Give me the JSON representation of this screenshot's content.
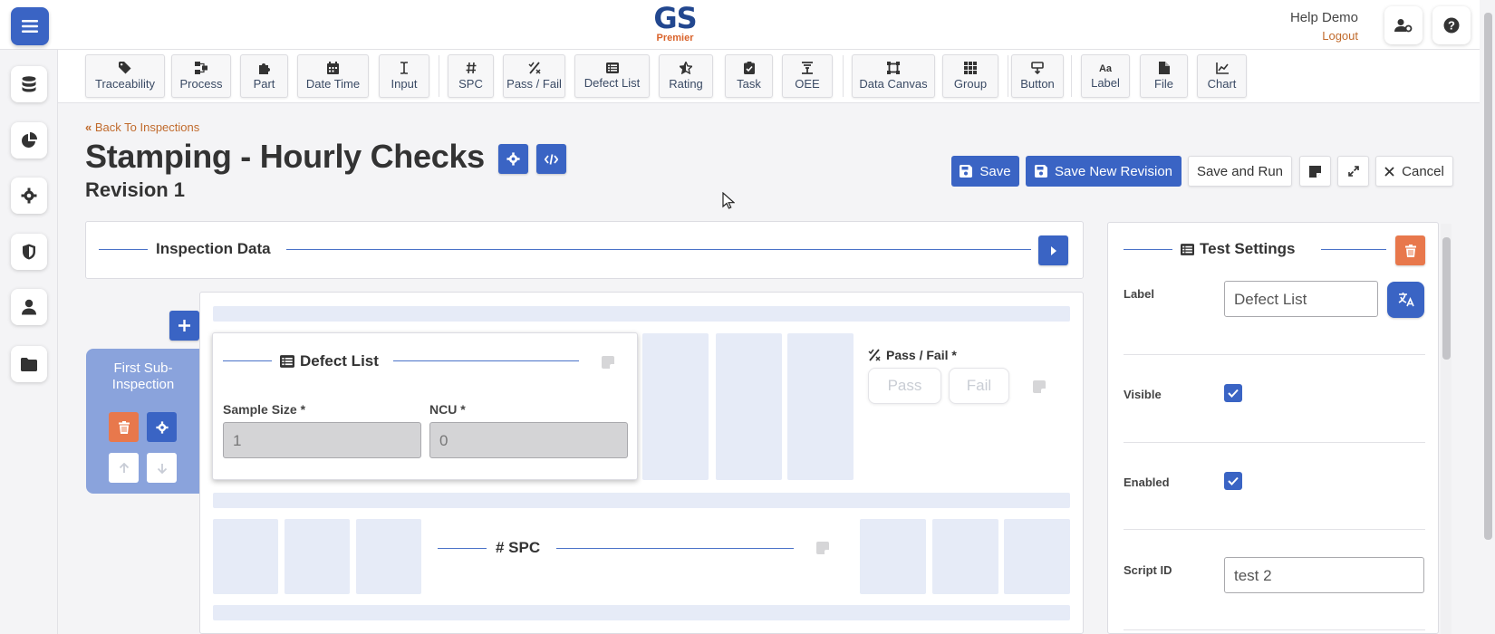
{
  "header": {
    "logo_main": "GS",
    "logo_sub": "Premier",
    "user_name": "Help Demo",
    "logout_label": "Logout"
  },
  "toolbar": {
    "items": [
      {
        "label": "Traceability",
        "icon": "tag-icon"
      },
      {
        "label": "Process",
        "icon": "process-icon"
      },
      {
        "label": "Part",
        "icon": "puzzle-icon"
      },
      {
        "label": "Date Time",
        "icon": "calendar-icon"
      },
      {
        "label": "Input",
        "icon": "text-cursor-icon"
      },
      {
        "label": "SPC",
        "icon": "hash-icon"
      },
      {
        "label": "Pass / Fail",
        "icon": "percent-icon"
      },
      {
        "label": "Defect List",
        "icon": "list-icon"
      },
      {
        "label": "Rating",
        "icon": "star-icon"
      },
      {
        "label": "Task",
        "icon": "clipboard-check-icon"
      },
      {
        "label": "OEE",
        "icon": "oee-icon"
      },
      {
        "label": "Data Canvas",
        "icon": "canvas-icon"
      },
      {
        "label": "Group",
        "icon": "grid-icon"
      },
      {
        "label": "Button",
        "icon": "button-icon"
      },
      {
        "label": "Label",
        "icon": "label-icon"
      },
      {
        "label": "File",
        "icon": "file-icon"
      },
      {
        "label": "Chart",
        "icon": "chart-icon"
      }
    ]
  },
  "page": {
    "back_label": "Back To Inspections",
    "title": "Stamping - Hourly Checks",
    "subtitle": "Revision 1"
  },
  "actions": {
    "save": "Save",
    "save_new_revision": "Save New Revision",
    "save_and_run": "Save and Run",
    "cancel": "Cancel"
  },
  "inspection_data": {
    "title": "Inspection Data"
  },
  "sub_inspection": {
    "title": "First Sub-Inspection"
  },
  "defect_list": {
    "title": "Defect List",
    "sample_size_label": "Sample Size *",
    "sample_size_value": "1",
    "ncu_label": "NCU *",
    "ncu_value": "0"
  },
  "pass_fail": {
    "title": "Pass / Fail *",
    "pass_label": "Pass",
    "fail_label": "Fail"
  },
  "spc": {
    "title": "# SPC"
  },
  "test_settings": {
    "title": "Test Settings",
    "label_field_label": "Label",
    "label_value": "Defect List",
    "visible_label": "Visible",
    "visible_checked": true,
    "enabled_label": "Enabled",
    "enabled_checked": true,
    "script_id_label": "Script ID",
    "script_id_value": "test 2"
  },
  "colors": {
    "primary": "#3a64c4",
    "danger": "#e8784c",
    "accent_text": "#c06a2c",
    "placeholder": "#e6ebf7"
  }
}
